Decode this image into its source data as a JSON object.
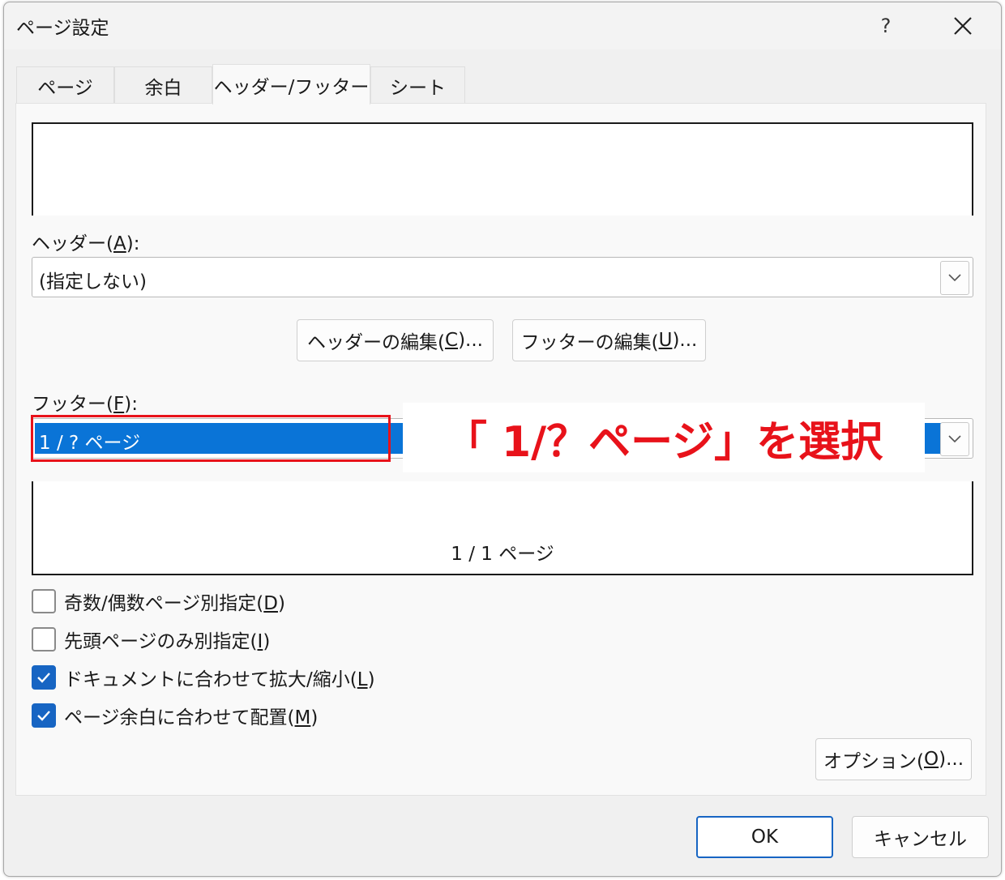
{
  "window": {
    "title": "ページ設定",
    "help_label": "?",
    "close_icon": "close-icon"
  },
  "tabs": [
    {
      "label": "ページ",
      "active": false
    },
    {
      "label": "余白",
      "active": false
    },
    {
      "label": "ヘッダー/フッター",
      "active": true
    },
    {
      "label": "シート",
      "active": false
    }
  ],
  "header": {
    "label_pre": "ヘッダー(",
    "label_key": "A",
    "label_post": "):",
    "selected_value": "(指定しない)"
  },
  "edit_buttons": {
    "header_edit_pre": "ヘッダーの編集(",
    "header_edit_key": "C",
    "header_edit_post": ")...",
    "footer_edit_pre": "フッターの編集(",
    "footer_edit_key": "U",
    "footer_edit_post": ")..."
  },
  "footer": {
    "label_pre": "フッター(",
    "label_key": "F",
    "label_post": "):",
    "selected_value": "1 / ? ページ",
    "preview_text": "1 / 1 ページ"
  },
  "options": [
    {
      "pre": "奇数/偶数ページ別指定(",
      "key": "D",
      "post": ")",
      "checked": false
    },
    {
      "pre": "先頭ページのみ別指定(",
      "key": "I",
      "post": ")",
      "checked": false
    },
    {
      "pre": "ドキュメントに合わせて拡大/縮小(",
      "key": "L",
      "post": ")",
      "checked": true
    },
    {
      "pre": "ページ余白に合わせて配置(",
      "key": "M",
      "post": ")",
      "checked": true
    }
  ],
  "options_button": {
    "pre": "オプション(",
    "key": "O",
    "post": ")..."
  },
  "footer_buttons": {
    "ok_label": "OK",
    "cancel_label": "キャンセル"
  },
  "annotation": {
    "callout_text": "「 1/？ページ」を選択",
    "color": "#e8121a"
  },
  "colors": {
    "selection": "#0a74d7",
    "checkbox_checked": "#1765c3"
  }
}
